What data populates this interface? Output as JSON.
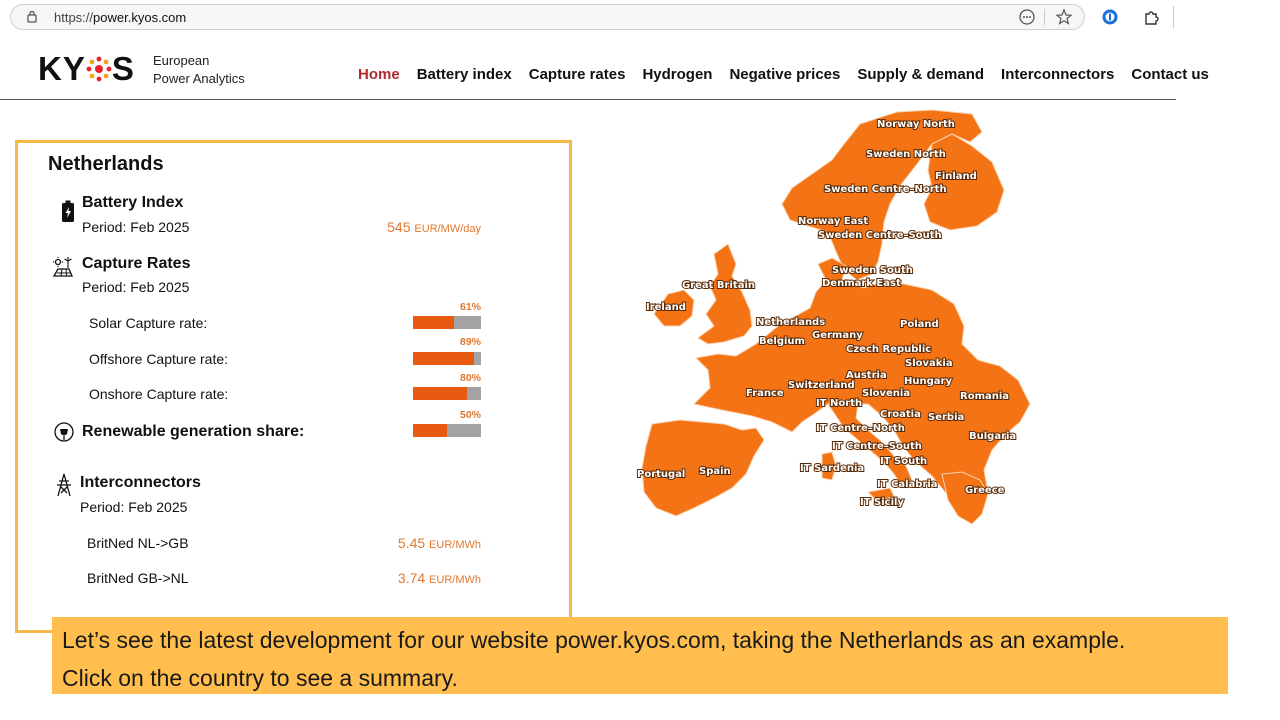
{
  "browser": {
    "url_prefix": "https://",
    "url_domain": "power.kyos.com"
  },
  "header": {
    "logo": "KYOS",
    "tagline_line1": "European",
    "tagline_line2": "Power Analytics",
    "nav": [
      "Home",
      "Battery index",
      "Capture rates",
      "Hydrogen",
      "Negative prices",
      "Supply & demand",
      "Interconnectors",
      "Contact us"
    ],
    "active_nav": "Home"
  },
  "panel": {
    "country": "Netherlands",
    "battery": {
      "title": "Battery Index",
      "period": "Period: Feb 2025",
      "value": "545",
      "unit": "EUR/MW/day"
    },
    "capture": {
      "title": "Capture Rates",
      "period": "Period: Feb 2025",
      "rows": [
        {
          "label": "Solar Capture rate:",
          "pct_text": "61%",
          "pct": 0.61
        },
        {
          "label": "Offshore Capture rate:",
          "pct_text": "89%",
          "pct": 0.89
        },
        {
          "label": "Onshore Capture rate:",
          "pct_text": "80%",
          "pct": 0.8
        }
      ]
    },
    "renewable": {
      "title": "Renewable generation share:",
      "pct_text": "50%",
      "pct": 0.5
    },
    "interconnectors": {
      "title": "Interconnectors",
      "period": "Period: Feb 2025",
      "rows": [
        {
          "label": "BritNed NL->GB",
          "value": "5.45",
          "unit": "EUR/MWh"
        },
        {
          "label": "BritNed GB->NL",
          "value": "3.74",
          "unit": "EUR/MWh"
        }
      ]
    }
  },
  "map": {
    "labels": [
      "Norway North",
      "Sweden North",
      "Finland",
      "Sweden Centre–North",
      "Norway East",
      "Sweden Centre–South",
      "Sweden South",
      "Denmark East",
      "Great Britain",
      "Ireland",
      "Netherlands",
      "Germany",
      "Poland",
      "Belgium",
      "Czech Republic",
      "Slovakia",
      "Austria",
      "Hungary",
      "France",
      "Switzerland",
      "Slovenia",
      "Romania",
      "IT North",
      "Croatia",
      "Serbia",
      "IT Centre–North",
      "IT Centre–South",
      "Bulgaria",
      "IT South",
      "IT Sardenia",
      "Portugal",
      "Spain",
      "IT Calabria",
      "Greece",
      "IT Sicily"
    ],
    "fill_color": "#f47314"
  },
  "caption": {
    "line1": "Let’s see the latest development for our website power.kyos.com, taking the Netherlands as an example.",
    "line2": "Click on the country to see a summary."
  },
  "colors": {
    "accent": "#e85a10",
    "panel_border": "#f5b94a",
    "caption_bg": "#ffbe4d",
    "active_nav": "#b2292e"
  }
}
